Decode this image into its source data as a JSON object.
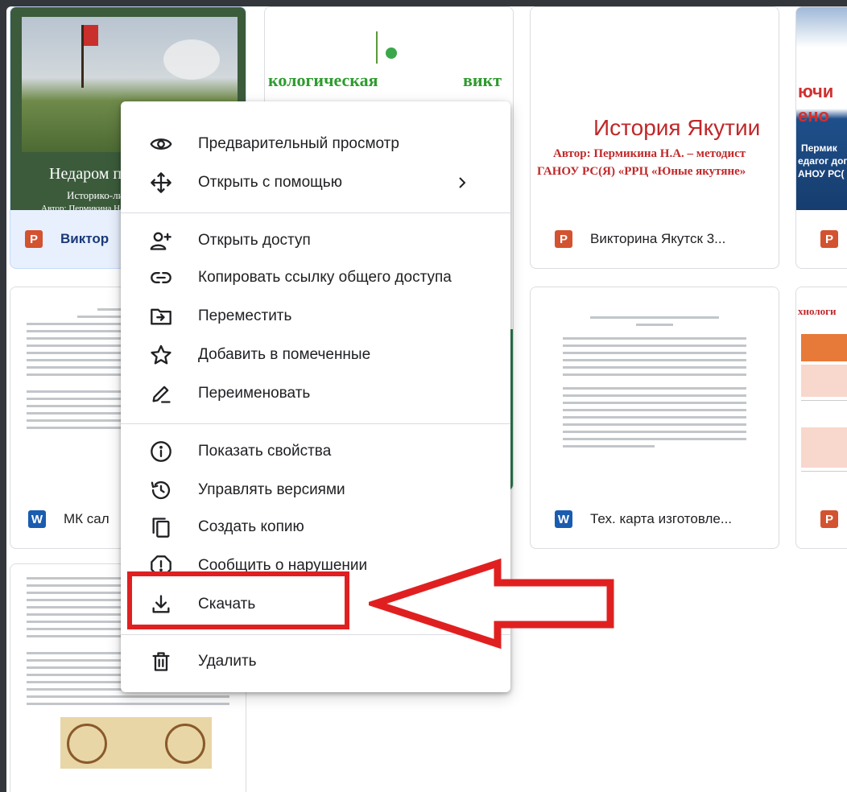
{
  "cards": {
    "c1": {
      "title": "Недаром по",
      "subtitle": "Историко-лите",
      "author": "Автор: Пермикина Надеж",
      "name": "Виктор",
      "type": "P"
    },
    "c2": {
      "left_text": "кологическая",
      "right_text": "викт"
    },
    "c3": {
      "title": "История Якутии",
      "line1": "Автор: Пермикина Н.А. – методист",
      "line2": "ГАНОУ РС(Я) «РРЦ «Юные якутяне»",
      "name": "Викторина Якутск 3...",
      "type": "P"
    },
    "c4": {
      "line1": "ючи",
      "line2": "ено",
      "line3": "Пермик",
      "line4": "едагог допо",
      "line5": "АНОУ РС(",
      "type": "P"
    },
    "c5": {
      "name": "МК сал",
      "type": "W"
    },
    "c7": {
      "name": "Тех. карта изготовле...",
      "type": "W"
    },
    "c8": {
      "header": "хнологи",
      "type": "P"
    }
  },
  "menu": {
    "items": [
      {
        "label": "Предварительный просмотр",
        "icon": "eye-icon"
      },
      {
        "label": "Открыть с помощью",
        "icon": "move-icon",
        "submenu": true
      },
      {
        "label": "Открыть доступ",
        "icon": "person-add-icon"
      },
      {
        "label": "Копировать ссылку общего доступа",
        "icon": "link-icon"
      },
      {
        "label": "Переместить",
        "icon": "move-to-folder-icon"
      },
      {
        "label": "Добавить в помеченные",
        "icon": "star-icon"
      },
      {
        "label": "Переименовать",
        "icon": "pencil-icon"
      },
      {
        "label": "Показать свойства",
        "icon": "info-icon"
      },
      {
        "label": "Управлять версиями",
        "icon": "history-icon"
      },
      {
        "label": "Создать копию",
        "icon": "copy-icon"
      },
      {
        "label": "Сообщить о нарушении",
        "icon": "report-icon"
      },
      {
        "label": "Скачать",
        "icon": "download-icon"
      },
      {
        "label": "Удалить",
        "icon": "trash-icon"
      }
    ]
  },
  "colors": {
    "highlight": "#e02020",
    "selected_card": "#e8f0fe",
    "ppt_icon": "#d35230",
    "word_icon": "#1a5cb0",
    "title_red": "#c0282a"
  }
}
